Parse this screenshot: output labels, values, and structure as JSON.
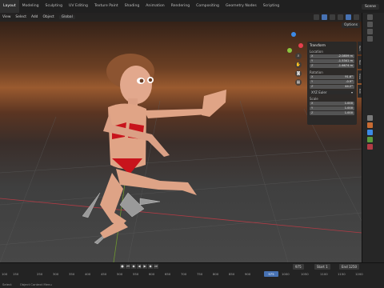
{
  "topbar": {
    "workspaces": [
      "Layout",
      "Modeling",
      "Sculpting",
      "UV Editing",
      "Texture Paint",
      "Shading",
      "Animation",
      "Rendering",
      "Compositing",
      "Geometry Nodes",
      "Scripting"
    ],
    "active_workspace": "Layout",
    "scene_label": "Scene"
  },
  "viewport": {
    "header_items": [
      "View",
      "Select",
      "Add",
      "Object"
    ],
    "orientation": "Global",
    "options_label": "Options",
    "gizmo_colors": {
      "x": "#e63e4d",
      "y": "#8bc53f",
      "z": "#3c8ae6"
    }
  },
  "npanel": {
    "section_title": "Transform",
    "location_label": "Location",
    "location": [
      {
        "axis": "X",
        "value": "-2.0859 m"
      },
      {
        "axis": "Y",
        "value": "-1.5341 m"
      },
      {
        "axis": "Z",
        "value": "-1.6674 m"
      }
    ],
    "rotation_label": "Rotation",
    "rotation": [
      {
        "axis": "X",
        "value": "91.6°"
      },
      {
        "axis": "Y",
        "value": "-0.9°"
      },
      {
        "axis": "Z",
        "value": "44.2°"
      }
    ],
    "rotation_mode": "XYZ Euler",
    "scale_label": "Scale",
    "scale": [
      {
        "axis": "X",
        "value": "1.000"
      },
      {
        "axis": "Y",
        "value": "1.000"
      },
      {
        "axis": "Z",
        "value": "1.000"
      }
    ],
    "tabs": [
      "Item",
      "Tool",
      "View",
      "Edit"
    ]
  },
  "timeline": {
    "current_frame": "975",
    "start_label": "Start",
    "start_value": "1",
    "end_label": "End",
    "end_value": "1250",
    "ruler_ticks": [
      "100",
      "150",
      "250",
      "300",
      "350",
      "400",
      "450",
      "500",
      "550",
      "600",
      "650",
      "700",
      "750",
      "800",
      "850",
      "900",
      "975",
      "1000",
      "1050",
      "1100",
      "1150",
      "1200"
    ],
    "playhead_label": "975"
  },
  "statusbar": {
    "items": [
      "Select",
      "Object Context Menu"
    ]
  }
}
